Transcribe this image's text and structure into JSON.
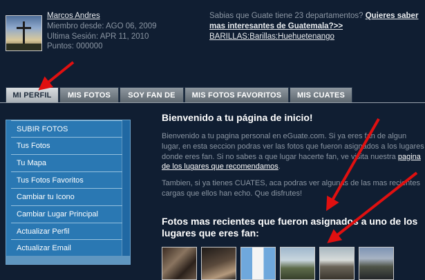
{
  "user": {
    "name": "Marcos Andres",
    "member_since": "Miembro desde: AGO 06, 2009",
    "last_session": "Ultima Sesión: APR 11, 2010",
    "points": "Puntos: 000000"
  },
  "promo": {
    "text": "Sabias que Guate tiene 23 departamentos?",
    "link": "Quieres saber mas interesantes de Guatemala?>>",
    "location": "BARILLAS:Barillas:Huehuetenango"
  },
  "tabs": [
    {
      "label": "MI PERFIL",
      "active": true
    },
    {
      "label": "MIS FOTOS",
      "active": false
    },
    {
      "label": "SOY FAN DE",
      "active": false
    },
    {
      "label": "MIS FOTOS FAVORITOS",
      "active": false
    },
    {
      "label": "MIS CUATES",
      "active": false
    }
  ],
  "sidebar": {
    "items": [
      {
        "label": "SUBIR FOTOS"
      },
      {
        "label": "Tus Fotos"
      },
      {
        "label": "Tu Mapa"
      },
      {
        "label": "Tus Fotos Favoritos"
      },
      {
        "label": "Cambiar tu Icono"
      },
      {
        "label": "Cambiar Lugar Principal"
      },
      {
        "label": "Actualizar Perfil"
      },
      {
        "label": "Actualizar Email"
      }
    ]
  },
  "main": {
    "welcome_title": "Bienvenido a tu página de inicio!",
    "welcome_text": "Bienvenido a tu pagina personal en eGuate.com.  Si ya eres fan de algun lugar, en esta seccion podras ver las fotos que fueron asignados a los lugares donde eres fan.  Si no sabes a que lugar hacerte fan, ve visita nuestra",
    "welcome_link": "pagina de los lugares que recomendamos",
    "welcome_end": ".",
    "cuates_text": "Tambien, si ya tienes CUATES, aca podras ver algunas de las mas recientes cargas que ellos han echo.  Que disfrutes!",
    "recent_title": "Fotos mas recientes que fueron asignados a uno de los lugares que eres fan:"
  },
  "colors": {
    "background": "#101e32",
    "sidebar": "#2a78b3",
    "tab_active": "#d9dde0",
    "arrow": "#e01010"
  }
}
